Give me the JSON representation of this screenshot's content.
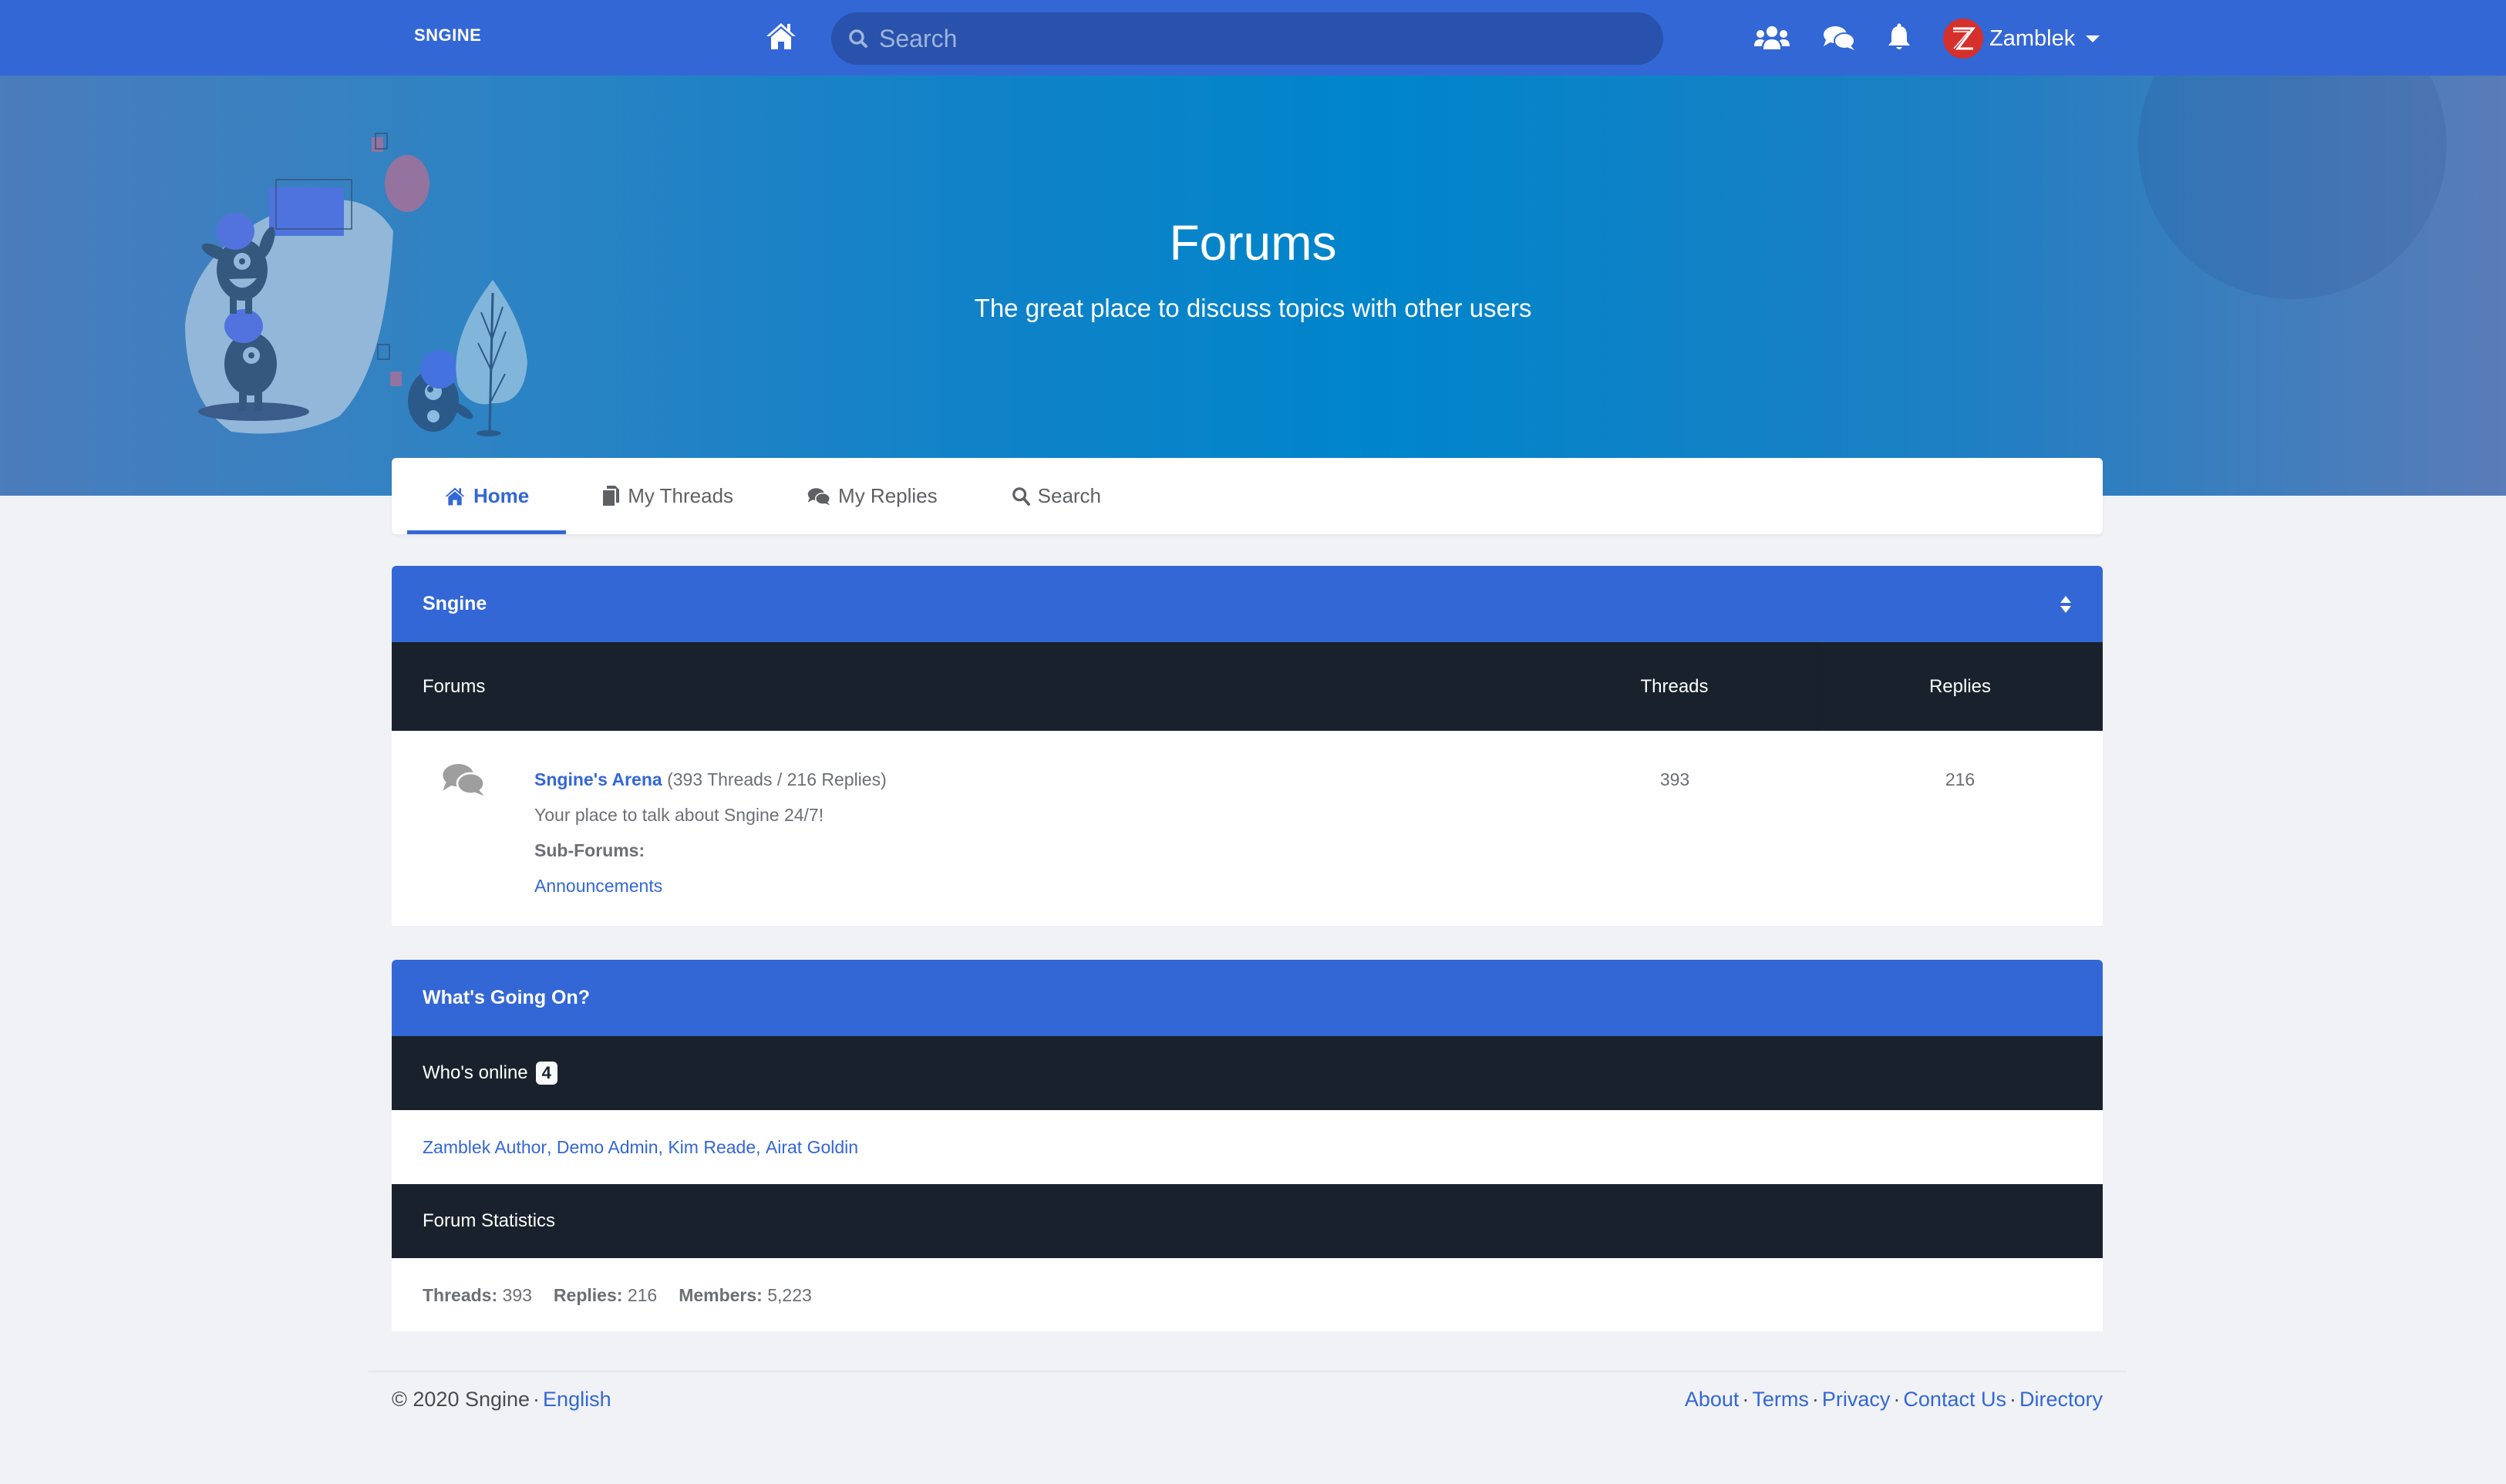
{
  "header": {
    "logo": "SNGINE",
    "search_placeholder": "Search",
    "user_name": "Zamblek",
    "colors": {
      "primary": "#3367d6",
      "search_bg": "#2852ab",
      "avatar": "#d5302b"
    }
  },
  "hero": {
    "title": "Forums",
    "subtitle": "The great place to discuss topics with other users"
  },
  "tabs": [
    {
      "label": "Home",
      "icon": "home-icon",
      "active": true
    },
    {
      "label": "My Threads",
      "icon": "copy-icon",
      "active": false
    },
    {
      "label": "My Replies",
      "icon": "comments-icon",
      "active": false
    },
    {
      "label": "Search",
      "icon": "search-icon",
      "active": false
    }
  ],
  "category": {
    "title": "Sngine",
    "columns": {
      "forums": "Forums",
      "threads": "Threads",
      "replies": "Replies"
    },
    "forums": [
      {
        "name": "Sngine's Arena",
        "counts": "(393 Threads / 216 Replies)",
        "description": "Your place to talk about Sngine 24/7!",
        "subforums_label": "Sub-Forums:",
        "subforums": [
          "Announcements"
        ],
        "threads": "393",
        "replies": "216"
      }
    ]
  },
  "whats_going_on": {
    "title": "What's Going On?",
    "online_label": "Who's online",
    "online_count": "4",
    "online_users": [
      "Zamblek Author",
      "Demo Admin",
      "Kim Reade",
      "Airat Goldin"
    ],
    "stats_label": "Forum Statistics",
    "stats": [
      {
        "label": "Threads",
        "value": "393"
      },
      {
        "label": "Replies",
        "value": "216"
      },
      {
        "label": "Members",
        "value": "5,223"
      }
    ]
  },
  "footer": {
    "copyright": "© 2020 Sngine",
    "language": "English",
    "links": [
      "About",
      "Terms",
      "Privacy",
      "Contact Us",
      "Directory"
    ]
  }
}
